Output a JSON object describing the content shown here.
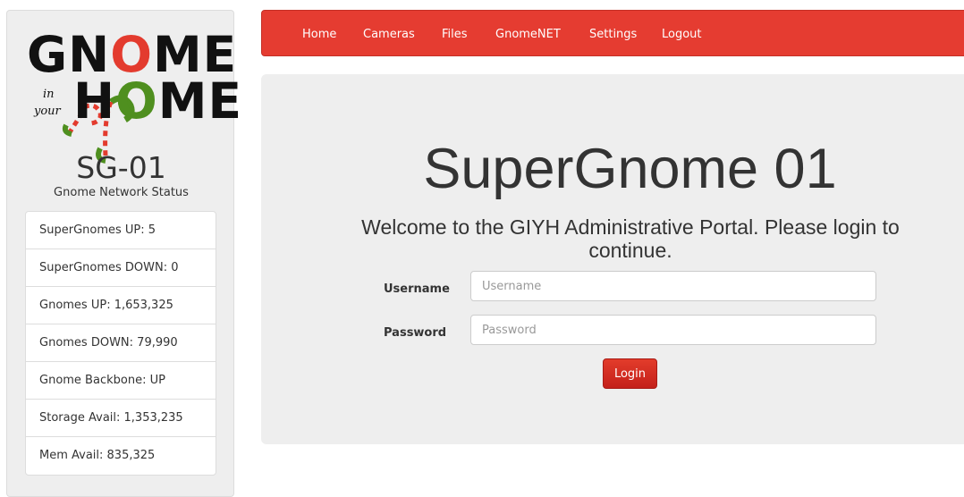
{
  "brand": {
    "logo_top": "GNOME",
    "logo_bottom": "HOME",
    "logo_in": "in",
    "logo_your": "your",
    "colors": {
      "red": "#e33b2e",
      "green": "#4f8f1f",
      "black": "#111111"
    }
  },
  "sidebar": {
    "device_name": "SG-01",
    "status_heading": "Gnome Network Status",
    "status_items": [
      {
        "label": "SuperGnomes UP: 5"
      },
      {
        "label": "SuperGnomes DOWN: 0"
      },
      {
        "label": "Gnomes UP: 1,653,325"
      },
      {
        "label": "Gnomes DOWN: 79,990"
      },
      {
        "label": "Gnome Backbone: UP"
      },
      {
        "label": "Storage Avail: 1,353,235"
      },
      {
        "label": "Mem Avail: 835,325"
      }
    ]
  },
  "nav": {
    "accent_color": "#e53c31",
    "items": [
      {
        "label": "Home"
      },
      {
        "label": "Cameras"
      },
      {
        "label": "Files"
      },
      {
        "label": "GnomeNET"
      },
      {
        "label": "Settings"
      },
      {
        "label": "Logout"
      }
    ]
  },
  "main": {
    "title": "SuperGnome 01",
    "welcome": "Welcome to the GIYH Administrative Portal. Please login to continue.",
    "username_label": "Username",
    "username_placeholder": "Username",
    "username_value": "",
    "password_label": "Password",
    "password_placeholder": "Password",
    "password_value": "",
    "login_label": "Login"
  }
}
